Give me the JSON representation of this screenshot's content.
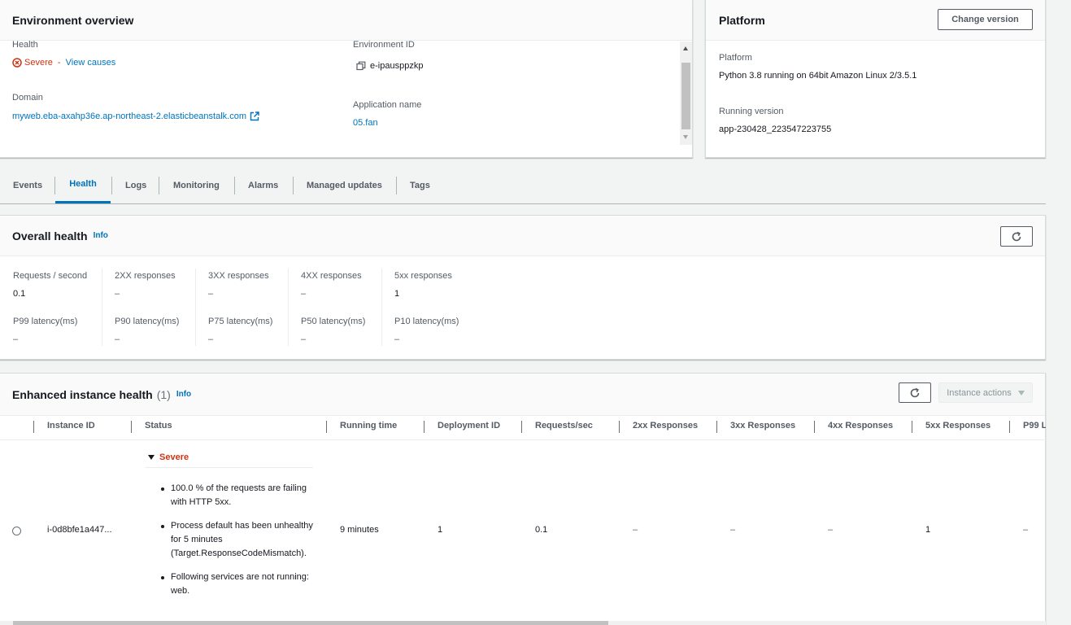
{
  "env_overview": {
    "title": "Environment overview",
    "health_label": "Health",
    "health_status": "Severe",
    "health_sep": " - ",
    "view_causes": "View causes",
    "domain_label": "Domain",
    "domain_value": "myweb.eba-axahp36e.ap-northeast-2.elasticbeanstalk.com",
    "env_id_label": "Environment ID",
    "env_id_value": "e-ipausppzkp",
    "app_name_label": "Application name",
    "app_name_value": "05.fan"
  },
  "platform": {
    "title": "Platform",
    "change_version": "Change version",
    "platform_label": "Platform",
    "platform_value": "Python 3.8 running on 64bit Amazon Linux 2/3.5.1",
    "running_version_label": "Running version",
    "running_version_value": "app-230428_223547223755"
  },
  "tabs": [
    "Events",
    "Health",
    "Logs",
    "Monitoring",
    "Alarms",
    "Managed updates",
    "Tags"
  ],
  "active_tab": "Health",
  "overall": {
    "title": "Overall health",
    "info": "Info",
    "metrics_row1": [
      {
        "label": "Requests / second",
        "value": "0.1"
      },
      {
        "label": "2XX responses",
        "value": "–"
      },
      {
        "label": "3XX responses",
        "value": "–"
      },
      {
        "label": "4XX responses",
        "value": "–"
      },
      {
        "label": "5xx responses",
        "value": "1"
      }
    ],
    "metrics_row2": [
      {
        "label": "P99 latency(ms)",
        "value": "–"
      },
      {
        "label": "P90 latency(ms)",
        "value": "–"
      },
      {
        "label": "P75 latency(ms)",
        "value": "–"
      },
      {
        "label": "P50 latency(ms)",
        "value": "–"
      },
      {
        "label": "P10 latency(ms)",
        "value": "–"
      }
    ]
  },
  "enhanced": {
    "title": "Enhanced instance health",
    "count": "(1)",
    "info": "Info",
    "instance_actions": "Instance actions",
    "columns": [
      "Instance ID",
      "Status",
      "Running time",
      "Deployment ID",
      "Requests/sec",
      "2xx Responses",
      "3xx Responses",
      "4xx Responses",
      "5xx Responses",
      "P99 L"
    ],
    "row": {
      "instance_id": "i-0d8bfe1a447...",
      "status": "Severe",
      "causes": [
        "100.0 % of the requests are failing with HTTP 5xx.",
        "Process default has been unhealthy for 5 minutes (Target.ResponseCodeMismatch).",
        "Following services are not running: web."
      ],
      "running_time": "9 minutes",
      "deployment_id": "1",
      "requests_sec": "0.1",
      "r2xx": "–",
      "r3xx": "–",
      "r4xx": "–",
      "r5xx": "1",
      "p99": "–"
    }
  },
  "colors": {
    "severe": "#d13212",
    "link": "#0073bb",
    "text": "#16191f"
  }
}
